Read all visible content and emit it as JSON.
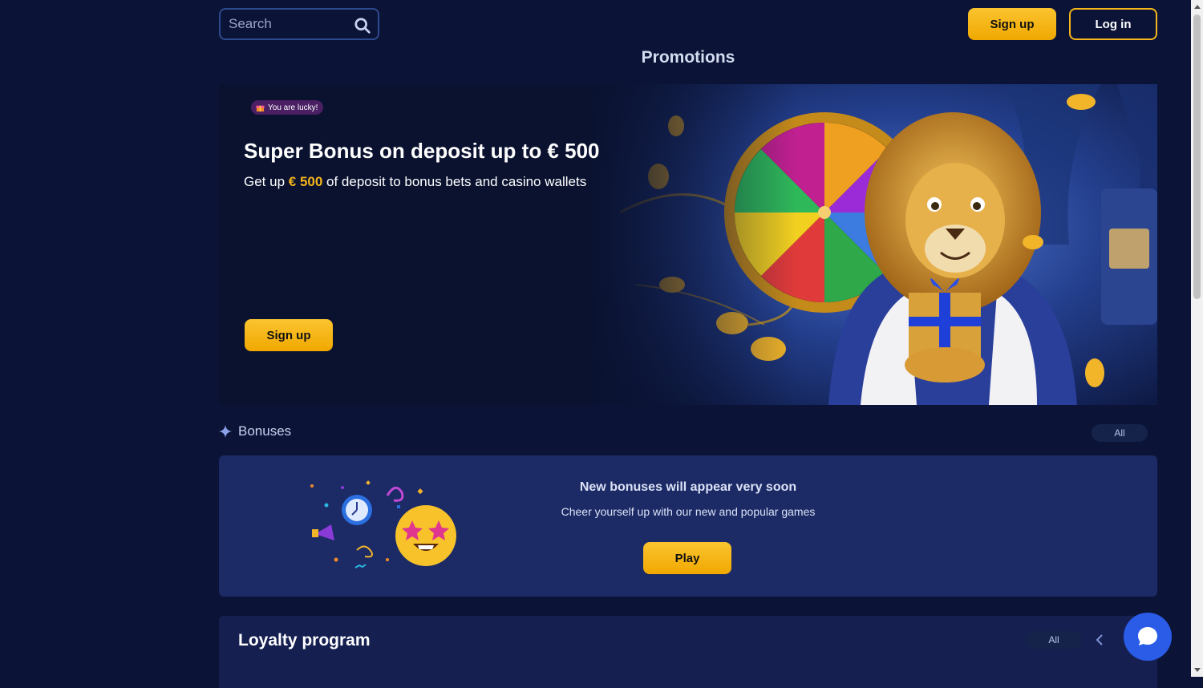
{
  "header": {
    "search_placeholder": "Search",
    "signup_label": "Sign up",
    "login_label": "Log in"
  },
  "page_title": "Promotions",
  "hero": {
    "badge": "You are lucky!",
    "title": "Super Bonus on deposit up to € 500",
    "subtitle_prefix": "Get up ",
    "subtitle_amount": "€ 500",
    "subtitle_suffix": " of deposit to bonus bets and casino wallets",
    "signup_label": "Sign up"
  },
  "bonuses": {
    "heading": "Bonuses",
    "all_label": "All",
    "empty_title": "New bonuses will appear very soon",
    "empty_subtitle": "Cheer yourself up with our new and popular games",
    "play_label": "Play"
  },
  "loyalty": {
    "heading": "Loyalty program",
    "all_label": "All"
  },
  "colors": {
    "background": "#0b1437",
    "accent_yellow": "#f5b51b",
    "card": "#1c2a66",
    "chat_blue": "#2a5ce8"
  },
  "icons": [
    "search-icon",
    "gift-icon",
    "sparkle-icon",
    "chevron-left-icon",
    "chat-icon",
    "lion-wheel-illustration",
    "party-emoji-illustration"
  ]
}
